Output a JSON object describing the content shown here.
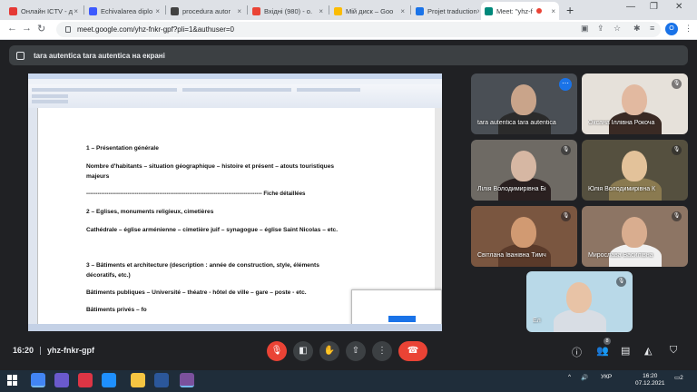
{
  "browser": {
    "tabs": [
      {
        "label": "Онлайн ICTV - д",
        "icon_color": "#e53935"
      },
      {
        "label": "Echivalarea diplo",
        "icon_color": "#3d5afe"
      },
      {
        "label": "procedura autor",
        "icon_color": "#424242"
      },
      {
        "label": "Вхідні (980) - o.",
        "icon_color": "#ea4335"
      },
      {
        "label": "Мій диск – Goo",
        "icon_color": "#fbbc04"
      },
      {
        "label": "Projet traduction",
        "icon_color": "#1a73e8"
      },
      {
        "label": "Meet: \"yhz-f",
        "icon_color": "#00897b"
      }
    ],
    "new_tab": "+",
    "url": "meet.google.com/yhz-fnkr-gpf?pli=1&authuser=0",
    "profile_initial": "O"
  },
  "banner": {
    "text": "tara autentica tara autentica на екрані"
  },
  "shared_doc": {
    "lines": [
      "1 – Présentation générale",
      "Nombre d'habitants – situation géographique – histoire et présent – atouts touristiques",
      "majeurs",
      "---------------------------------------------------------------------------------------------- Fiche détaillées",
      "2 – Eglises, monuments religieux, cimetières",
      "Cathédrale – église arménienne – cimetière juif – synagogue – église Saint Nicolas – etc.",
      "3 – Bâtiments et architecture (description : année de construction, style, éléments",
      "décoratifs, etc.)",
      "Bâtiments publiques – Université – théatre - hôtel de ville – gare – poste - etc.",
      "Bâtiments privés – fo"
    ]
  },
  "participants": [
    {
      "name": "tara autentica tara autentica",
      "muted": false,
      "bg": "#4a4f55",
      "skin": "#c9a48a",
      "shirt": "#2b2b2b"
    },
    {
      "name": "Оксана Іллівна Рокоча",
      "muted": true,
      "bg": "#e6e1da",
      "skin": "#e2b9a0",
      "shirt": "#3a2a24"
    },
    {
      "name": "Лілія Володимирівна Бі",
      "muted": true,
      "bg": "#6e6a64",
      "skin": "#d6b7a3",
      "shirt": "#2a2020"
    },
    {
      "name": "Юлія Володимирівна К",
      "muted": true,
      "bg": "#55503f",
      "skin": "#e3c29a",
      "shirt": "#8a7a50"
    },
    {
      "name": "Світлана Іванівна Тимч",
      "muted": true,
      "bg": "#7a5640",
      "skin": "#d19a72",
      "shirt": "#5a3a2a"
    },
    {
      "name": "Мирослава Василівна",
      "muted": true,
      "bg": "#8d7564",
      "skin": "#d9ad8f",
      "shirt": "#f0f0f0"
    },
    {
      "name": "Ел",
      "muted": true,
      "bg": "#b9d9e8",
      "skin": "#e8c3a6",
      "shirt": "#d8dde4"
    }
  ],
  "meeting": {
    "time": "16:20",
    "code": "yhz-fnkr-gpf",
    "participants_count": "8"
  },
  "taskbar": {
    "lang": "УКР",
    "time": "16:20",
    "date": "07.12.2021",
    "notif": "2"
  }
}
